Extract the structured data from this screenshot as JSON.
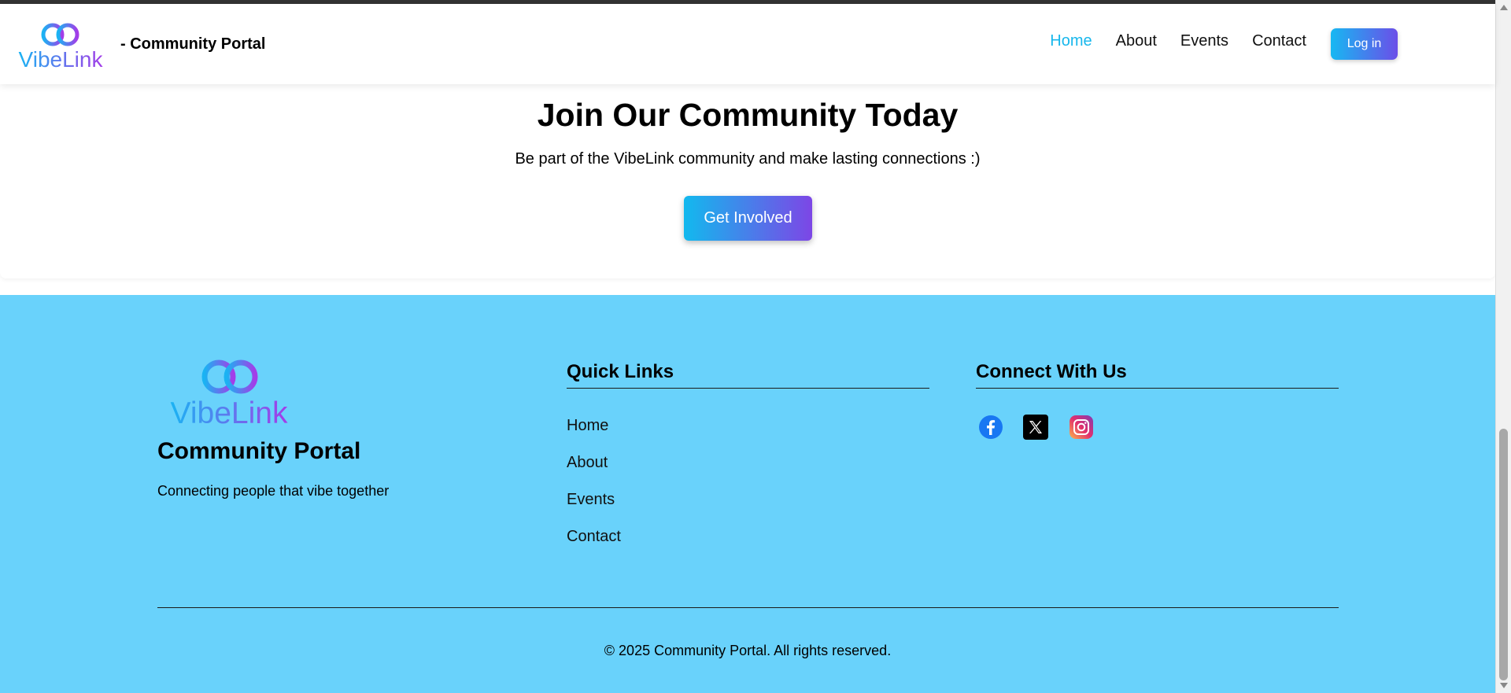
{
  "header": {
    "logo_text": "VibeLink",
    "title": "- Community Portal",
    "nav": [
      {
        "label": "Home",
        "active": true
      },
      {
        "label": "About",
        "active": false
      },
      {
        "label": "Events",
        "active": false
      },
      {
        "label": "Contact",
        "active": false
      }
    ],
    "login_label": "Log in"
  },
  "cta": {
    "heading": "Join Our Community Today",
    "subtext": "Be part of the VibeLink community and make lasting connections :)",
    "button_label": "Get Involved"
  },
  "footer": {
    "logo_text": "VibeLink",
    "title": "Community Portal",
    "tagline": "Connecting people that vibe together",
    "quick_links": {
      "heading": "Quick Links",
      "items": [
        "Home",
        "About",
        "Events",
        "Contact"
      ]
    },
    "connect": {
      "heading": "Connect With Us",
      "icons": [
        "facebook-icon",
        "x-twitter-icon",
        "instagram-icon"
      ]
    },
    "copyright": "© 2025 Community Portal. All rights reserved."
  },
  "colors": {
    "accent": "#17b7ec",
    "gradient_start": "#17b8f2",
    "gradient_end": "#7d46e6",
    "footer_bg": "#69d2fb"
  }
}
